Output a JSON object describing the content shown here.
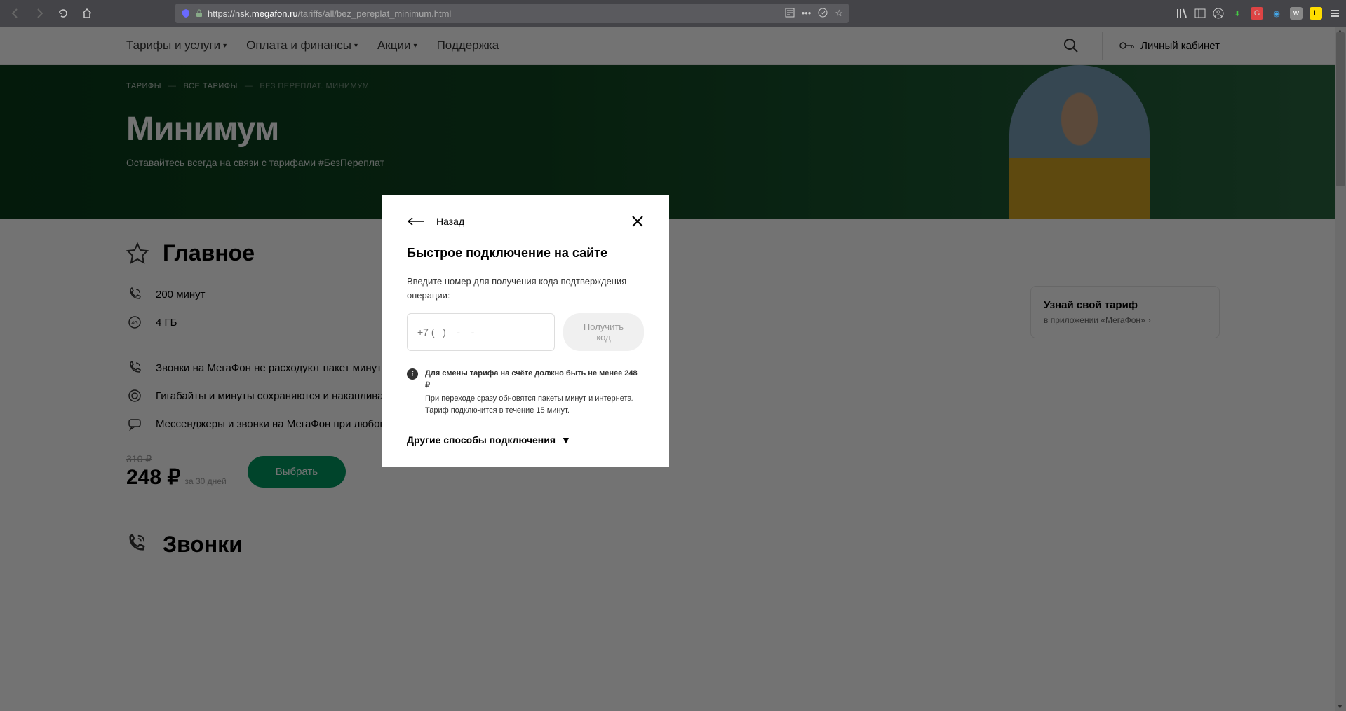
{
  "browser": {
    "url_prefix": "https://nsk.",
    "url_domain": "megafon.ru",
    "url_path": "/tariffs/all/bez_pereplat_minimum.html"
  },
  "header": {
    "nav": [
      "Тарифы и услуги",
      "Оплата и финансы",
      "Акции",
      "Поддержка"
    ],
    "personal": "Личный кабинет"
  },
  "breadcrumb": {
    "items": [
      "ТАРИФЫ",
      "ВСЕ ТАРИФЫ",
      "БЕЗ ПЕРЕПЛАТ. МИНИМУМ"
    ]
  },
  "hero": {
    "title": "Минимум",
    "subtitle": "Оставайтесь всегда на связи с тарифами #БезПереплат"
  },
  "main_section": {
    "title": "Главное",
    "specs": [
      "200 минут",
      "4 ГБ"
    ],
    "features": [
      "Звонки на МегаФон не расходуют пакет минут",
      "Гигабайты и минуты сохраняются и накапливаются",
      "Мессенджеры и звонки на МегаФон при любом балансе"
    ],
    "price_old": "310 ₽",
    "price_new": "248 ₽",
    "price_period": "за 30 дней",
    "select_button": "Выбрать"
  },
  "calls_section": {
    "title": "Звонки"
  },
  "side_card": {
    "title": "Узнай свой тариф",
    "link": "в приложении «МегаФон»"
  },
  "modal": {
    "back": "Назад",
    "title": "Быстрое подключение на сайте",
    "instruction": "Введите номер для получения кода подтверждения операции:",
    "phone_placeholder": "+7 (   )    -    -",
    "get_code": "Получить код",
    "info_line1": "Для смены тарифа на счёте должно быть не менее 248 ₽",
    "info_line2": "При переходе сразу обновятся пакеты минут и интернета. Тариф подключится в течение 15 минут.",
    "other_methods": "Другие способы подключения"
  }
}
